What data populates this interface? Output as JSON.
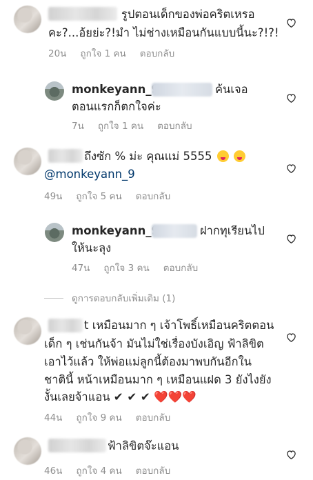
{
  "comments": [
    {
      "name": "comment-1",
      "text_lines": [
        "รูปตอนเด็กของพ่อคริตเหรอ",
        "คะ?...อ้ยย่ะ?!มำ ไม่ช่างเหมือนกันแบบนี้นะ?!?!"
      ],
      "time": "20น",
      "likes": "ถูกใจ 1 คน",
      "reply": "ตอบกลับ"
    },
    {
      "name": "reply-1",
      "username": "monkeyann_9",
      "text_after_mention": "ค้นเจอ",
      "text_line2": "ตอนแรกก็ตกใจค่ะ",
      "time": "7น",
      "likes": "ถูกใจ 1 คน",
      "reply": "ตอบกลับ"
    },
    {
      "name": "comment-2",
      "text_line1": "ถึงซัก % ม่ะ คุณแม่ 5555",
      "mention": "@monkeyann_9",
      "time": "49น",
      "likes": "ถูกใจ 5 คน",
      "reply": "ตอบกลับ"
    },
    {
      "name": "reply-2",
      "username": "monkeyann_9",
      "text_after_mention": "ฝากทุเรียนไป",
      "text_line2": "ให้นะลุง",
      "time": "47น",
      "likes": "ถูกใจ 3 คน",
      "reply": "ตอบกลับ"
    },
    {
      "name": "comment-3",
      "text_lines": [
        "t เหมือนมาก ๆ เจ้าโพธิ์เหมือนคริตตอน",
        "เด็ก ๆ เช่นกันจ้า มันไม่ใช่เรื่องบังเอิญ ฟ้าลิขิต",
        "เอาไว้แล้ว ให้พ่อแม่ลูกนี้ต้องมาพบกันอีกใน",
        "ชาตินี้ หน้าเหมือนมาก ๆ เหมือนแฝด 3 ยังไงยัง"
      ],
      "last_line": "งั้นเลยจ้าแอน",
      "checks": "✔ ✔ ✔",
      "hearts": "❤️❤️❤️",
      "time": "44น",
      "likes": "ถูกใจ 9 คน",
      "reply": "ตอบกลับ"
    },
    {
      "name": "comment-4",
      "text": "ฟ้าลิขิตจ๊ะแอน",
      "time": "46น",
      "likes": "ถูกใจ 4 คน",
      "reply": "ตอบกลับ"
    }
  ],
  "view_more_replies": "ดูการตอบกลับเพิ่มเติม (1)",
  "icons": {
    "like": "heart-outline-icon"
  },
  "colors": {
    "text": "#262626",
    "meta": "#8e8e8e",
    "mention": "#00376b",
    "heart_red": "#e8231a"
  }
}
